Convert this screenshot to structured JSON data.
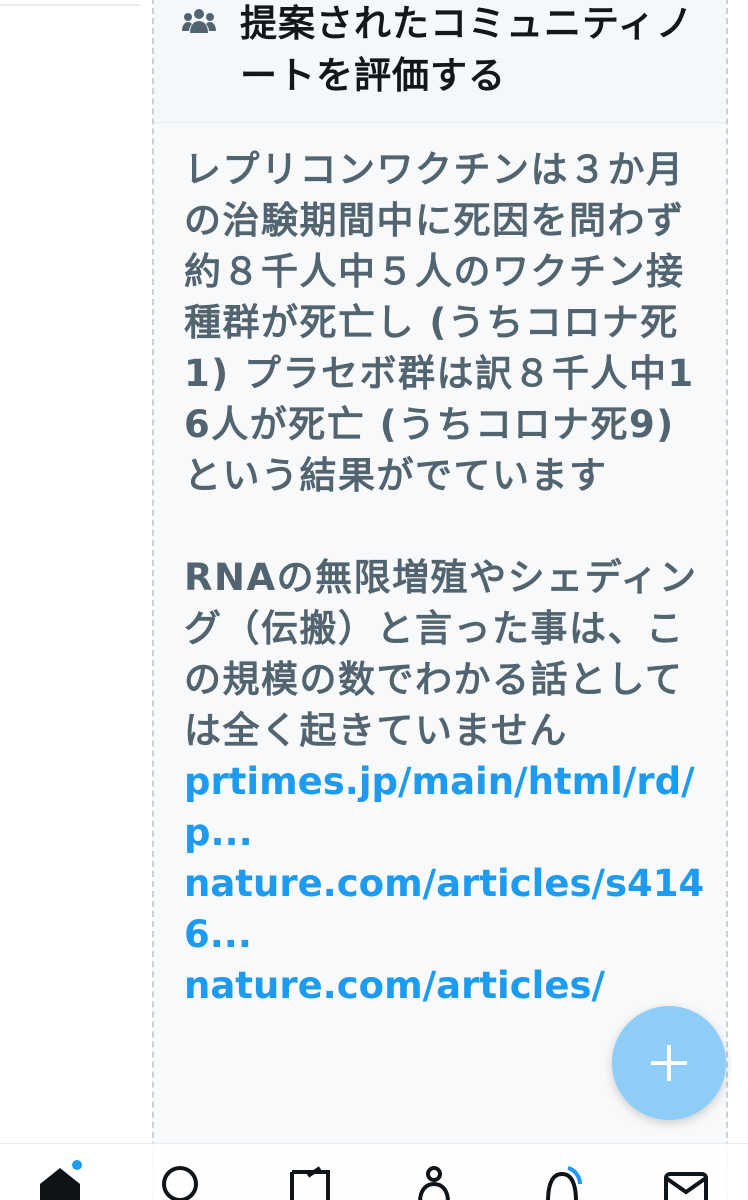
{
  "header": {
    "icon": "people-icon",
    "title": "提案されたコミュニティノートを評価する"
  },
  "note": {
    "paragraph1": "レプリコンワクチンは３か月の治験期間中に死因を問わず約８千人中５人のワクチン接種群が死亡し (うちコロナ死1) プラセボ群は訳８千人中16人が死亡 (うちコロナ死9) という結果がでています",
    "paragraph2": "RNAの無限増殖やシェディング（伝搬）と言った事は、この規模の数でわかる話としては全く起きていません",
    "links": [
      "prtimes.jp/main/html/rd/p...",
      "nature.com/articles/s4146...",
      "nature.com/articles/"
    ]
  },
  "fab": {
    "icon": "plus-icon"
  },
  "bottom_nav": {
    "tabs": [
      {
        "icon": "home-icon"
      },
      {
        "icon": "search-icon"
      },
      {
        "icon": "spaces-icon"
      },
      {
        "icon": "communities-icon"
      },
      {
        "icon": "notifications-icon"
      },
      {
        "icon": "mail-icon"
      }
    ]
  },
  "colors": {
    "accent": "#1d9bf0",
    "fab": "#8ecdf8",
    "text_primary": "#14171a",
    "text_secondary": "#536471"
  }
}
